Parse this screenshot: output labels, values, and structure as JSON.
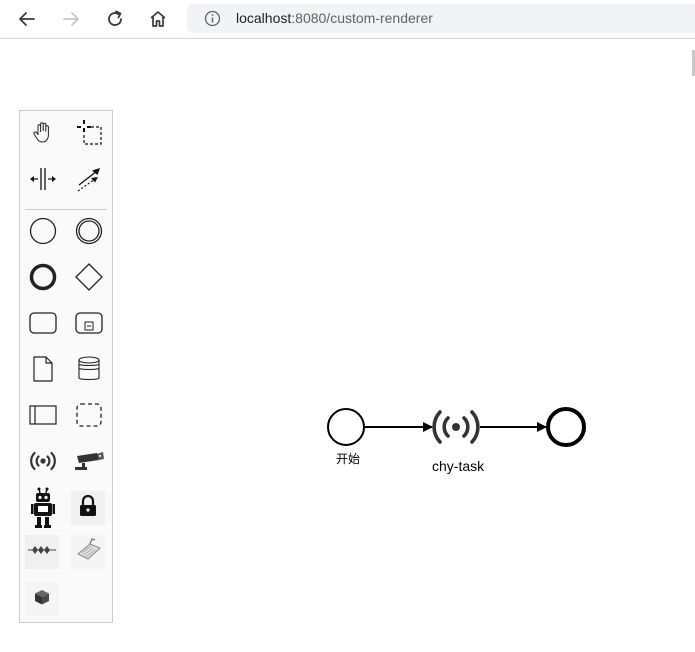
{
  "browser": {
    "url_host": "localhost",
    "url_path": ":8080/custom-renderer",
    "icons": [
      "back-arrow-icon",
      "forward-arrow-icon",
      "reload-icon",
      "home-icon",
      "info-icon"
    ]
  },
  "palette": {
    "tools": [
      {
        "name": "hand-tool",
        "icon": "hand-icon"
      },
      {
        "name": "lasso-tool",
        "icon": "lasso-icon"
      },
      {
        "name": "space-tool",
        "icon": "space-icon"
      },
      {
        "name": "global-connect-tool",
        "icon": "connect-icon"
      },
      {
        "name": "start-event",
        "icon": "circle-icon"
      },
      {
        "name": "intermediate-event",
        "icon": "double-circle-icon"
      },
      {
        "name": "end-event",
        "icon": "bold-circle-icon"
      },
      {
        "name": "gateway",
        "icon": "diamond-icon"
      },
      {
        "name": "task",
        "icon": "rounded-rect-icon"
      },
      {
        "name": "subprocess",
        "icon": "subprocess-icon"
      },
      {
        "name": "data-object",
        "icon": "document-icon"
      },
      {
        "name": "data-store",
        "icon": "database-icon"
      },
      {
        "name": "participant",
        "icon": "pool-icon"
      },
      {
        "name": "group",
        "icon": "dashed-rect-icon"
      },
      {
        "name": "custom-broadcast",
        "icon": "broadcast-icon"
      },
      {
        "name": "custom-camera",
        "icon": "camera-icon"
      },
      {
        "name": "custom-robot",
        "icon": "robot-icon"
      },
      {
        "name": "custom-lock",
        "icon": "lock-icon"
      },
      {
        "name": "custom-wave",
        "icon": "wave-icon"
      },
      {
        "name": "custom-scan",
        "icon": "scan-icon"
      },
      {
        "name": "custom-cube",
        "icon": "cube-icon"
      }
    ]
  },
  "diagram": {
    "start_event_label": "开始",
    "task_label": "chy-task",
    "colors": {
      "stroke": "#000000",
      "icon": "#333333"
    }
  }
}
